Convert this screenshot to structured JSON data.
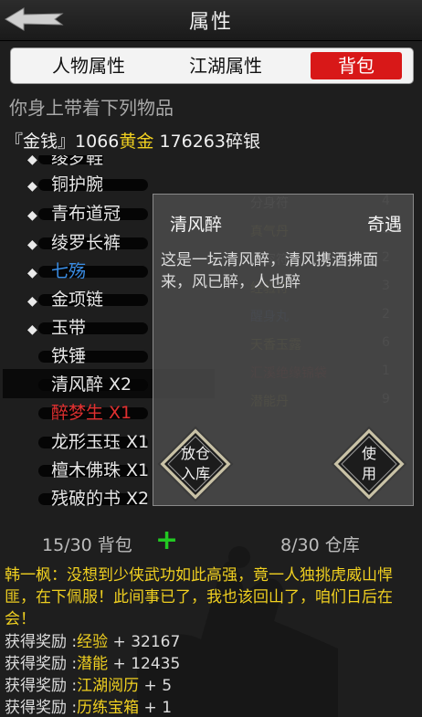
{
  "header": {
    "title": "属性"
  },
  "tabs": [
    {
      "label": "人物属性"
    },
    {
      "label": "江湖属性"
    },
    {
      "label": "背包"
    }
  ],
  "heading": "你身上带着下列物品",
  "money": {
    "bracket_label": "『金钱』",
    "gold_amount": "1066",
    "gold_word": "黄金",
    "silver": "176263碎银"
  },
  "items": [
    {
      "label": "绫罗鞋",
      "color": "#e6e6e6",
      "equipped": true
    },
    {
      "label": "铜护腕",
      "color": "#e6e6e6",
      "equipped": true
    },
    {
      "label": "青布道冠",
      "color": "#e6e6e6",
      "equipped": true
    },
    {
      "label": "绫罗长裤",
      "color": "#e6e6e6",
      "equipped": true
    },
    {
      "label": "七殇",
      "color": "#3a8ee6",
      "equipped": true
    },
    {
      "label": "金项链",
      "color": "#e6e6e6",
      "equipped": true
    },
    {
      "label": "玉带",
      "color": "#e6e6e6",
      "equipped": true
    },
    {
      "label": "铁锤",
      "color": "#e6e6e6",
      "equipped": false
    },
    {
      "label": "清风醉 X2",
      "color": "#e6e6e6",
      "equipped": false,
      "selected": true
    },
    {
      "label": "醉梦生 X1",
      "color": "#e03030",
      "equipped": false
    },
    {
      "label": "龙形玉珏 X1",
      "color": "#e6e6e6",
      "equipped": false
    },
    {
      "label": "檀木佛珠 X1",
      "color": "#e6e6e6",
      "equipped": false
    },
    {
      "label": "残破的书 X2",
      "color": "#e6e6e6",
      "equipped": false
    }
  ],
  "popup": {
    "item_name": "清风醉",
    "item_type": "奇遇",
    "description": "这是一坛清风醉，清风携酒拂面来，风已醉，人也醉",
    "store_button": "放仓\n入库",
    "use_button": "使\n用"
  },
  "warehouse_ghost": [
    {
      "name": "分身符",
      "count": "4",
      "color": "#cfcfcf"
    },
    {
      "name": "真气丹",
      "count": "1",
      "color": "#e0d040"
    },
    {
      "name": "易容符",
      "count": "2",
      "color": "#cfcfcf"
    },
    {
      "name": "经验符",
      "count": "3",
      "color": "#e0d040"
    },
    {
      "name": "醒身丸",
      "count": "2",
      "color": "#4a8ee6"
    },
    {
      "name": "天香玉露",
      "count": "6",
      "color": "#e0d040"
    },
    {
      "name": "汇溪绝缘锦袋",
      "count": "1",
      "color": "#d03030"
    },
    {
      "name": "潜能丹",
      "count": "9",
      "color": "#e0d040"
    }
  ],
  "footer": {
    "bag_count": "15/30 背包",
    "plus": "+",
    "warehouse_count": "8/30 仓库"
  },
  "dialog": "韩一枫：没想到少侠武功如此高强，竟一人独挑虎威山悍匪，在下佩服！此间事已了，我也该回山了，咱们日后在会！",
  "rewards": [
    {
      "prefix": "获得奖励 :",
      "name": "经验",
      "suffix": " + 32167"
    },
    {
      "prefix": "获得奖励 :",
      "name": "潜能",
      "suffix": " + 12435"
    },
    {
      "prefix": "获得奖励 :",
      "name": "江湖阅历",
      "suffix": " + 5"
    },
    {
      "prefix": "获得奖励 :",
      "name": "历练宝箱",
      "suffix": " + 1"
    }
  ]
}
